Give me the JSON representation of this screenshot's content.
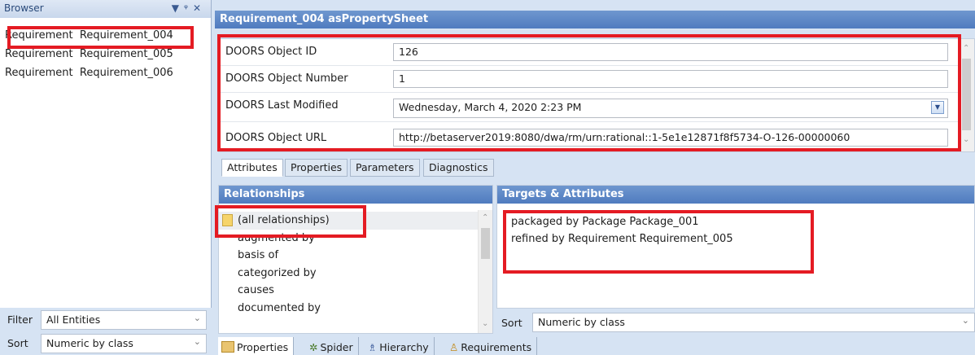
{
  "browser": {
    "title": "Browser",
    "items": [
      {
        "type": "Requirement",
        "name": "Requirement_004"
      },
      {
        "type": "Requirement",
        "name": "Requirement_005"
      },
      {
        "type": "Requirement",
        "name": "Requirement_006"
      }
    ],
    "filter_label": "Filter",
    "filter_value": "All Entities",
    "sort_label": "Sort",
    "sort_value": "Numeric by class"
  },
  "sheet": {
    "title": "Requirement_004 asPropertySheet",
    "properties": [
      {
        "label": "DOORS Object ID",
        "value": "126"
      },
      {
        "label": "DOORS Object Number",
        "value": "1"
      },
      {
        "label": "DOORS Last Modified",
        "value": "Wednesday, March  4, 2020 2:23  PM"
      },
      {
        "label": "DOORS Object URL",
        "value": "http://betaserver2019:8080/dwa/rm/urn:rational::1-5e1e12871f8f5734-O-126-00000060"
      }
    ],
    "tabs": [
      "Attributes",
      "Properties",
      "Parameters",
      "Diagnostics"
    ]
  },
  "relationships": {
    "title": "Relationships",
    "items": [
      "(all relationships)",
      "augmented by",
      "basis of",
      "categorized by",
      "causes",
      "documented by"
    ]
  },
  "targets": {
    "title": "Targets & Attributes",
    "items": [
      "packaged by Package  Package_001",
      "refined by Requirement  Requirement_005"
    ],
    "sort_label": "Sort",
    "sort_value": "Numeric by class"
  },
  "bottom_tabs": [
    "Properties",
    "Spider",
    "Hierarchy",
    "Requirements"
  ],
  "colors": {
    "highlight": "#e41b23",
    "title_bar": "#5a86c7",
    "background": "#d6e3f3"
  }
}
